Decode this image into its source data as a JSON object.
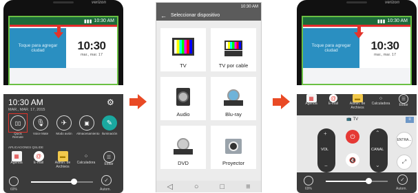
{
  "colors": {
    "accent_red": "#e3342b",
    "arrow_orange": "#e94a25",
    "lock_green": "#6ac043",
    "lock_blue": "#2a8fc1",
    "power_red": "#e53935"
  },
  "left_phone": {
    "brand": "verizon",
    "status_time": "10:30 AM",
    "lock": {
      "left_text": "Toque para agregar ciudad",
      "clock": "10:30",
      "date": "mar., mar. 17"
    }
  },
  "quick_settings": {
    "time": "10:30 AM",
    "date": "MAR., MAR. 17, 2015",
    "toggles": [
      {
        "label": "Quick Remote",
        "icon": "quick-remote-icon"
      },
      {
        "label": "Voice Mate",
        "icon": "microphone-icon"
      },
      {
        "label": "Modo avión",
        "icon": "airplane-icon"
      },
      {
        "label": "Almacenamiento",
        "icon": "storage-icon"
      },
      {
        "label": "Iluminación",
        "icon": "light-icon"
      }
    ],
    "section_title": "APLICACIONES QSLIDE",
    "apps": [
      {
        "label": "Agenda",
        "icon": "calendar-icon"
      },
      {
        "label": "E-mail",
        "icon": "email-icon"
      },
      {
        "label": "Admin. de Archivos",
        "icon": "folder-icon"
      },
      {
        "label": "Calculadora",
        "icon": "calculator-icon"
      },
      {
        "label": "Editar",
        "icon": "edit-icon"
      }
    ],
    "brightness_percent": "69%",
    "auto_label": "Autom."
  },
  "chooser": {
    "status_time": "10:30 AM",
    "title": "Seleccionar dispositivo",
    "devices": [
      {
        "label": "TV",
        "icon": "tv-icon"
      },
      {
        "label": "TV por cable",
        "icon": "cable-box-icon"
      },
      {
        "label": "Audio",
        "icon": "speaker-icon"
      },
      {
        "label": "Blu-ray",
        "icon": "disc-icon"
      },
      {
        "label": "DVD",
        "icon": "dvd-icon"
      },
      {
        "label": "Proyector",
        "icon": "projector-icon"
      }
    ]
  },
  "right_phone": {
    "brand": "verizon",
    "status_time": "10:30 AM",
    "lock": {
      "left_text": "Toque para agregar ciudad",
      "clock": "10:30",
      "date": "mar., mar. 17"
    }
  },
  "remote": {
    "apps": [
      {
        "label": "Agenda"
      },
      {
        "label": "E-mail"
      },
      {
        "label": "Admin. de Archivos"
      },
      {
        "label": "Calculadora"
      },
      {
        "label": "Editar"
      }
    ],
    "device_tab": "TV",
    "vol_label": "VOL",
    "canal_label": "CANAL",
    "entrada_label": "ENTRA...",
    "brightness_percent": "69%",
    "auto_label": "Autom."
  }
}
